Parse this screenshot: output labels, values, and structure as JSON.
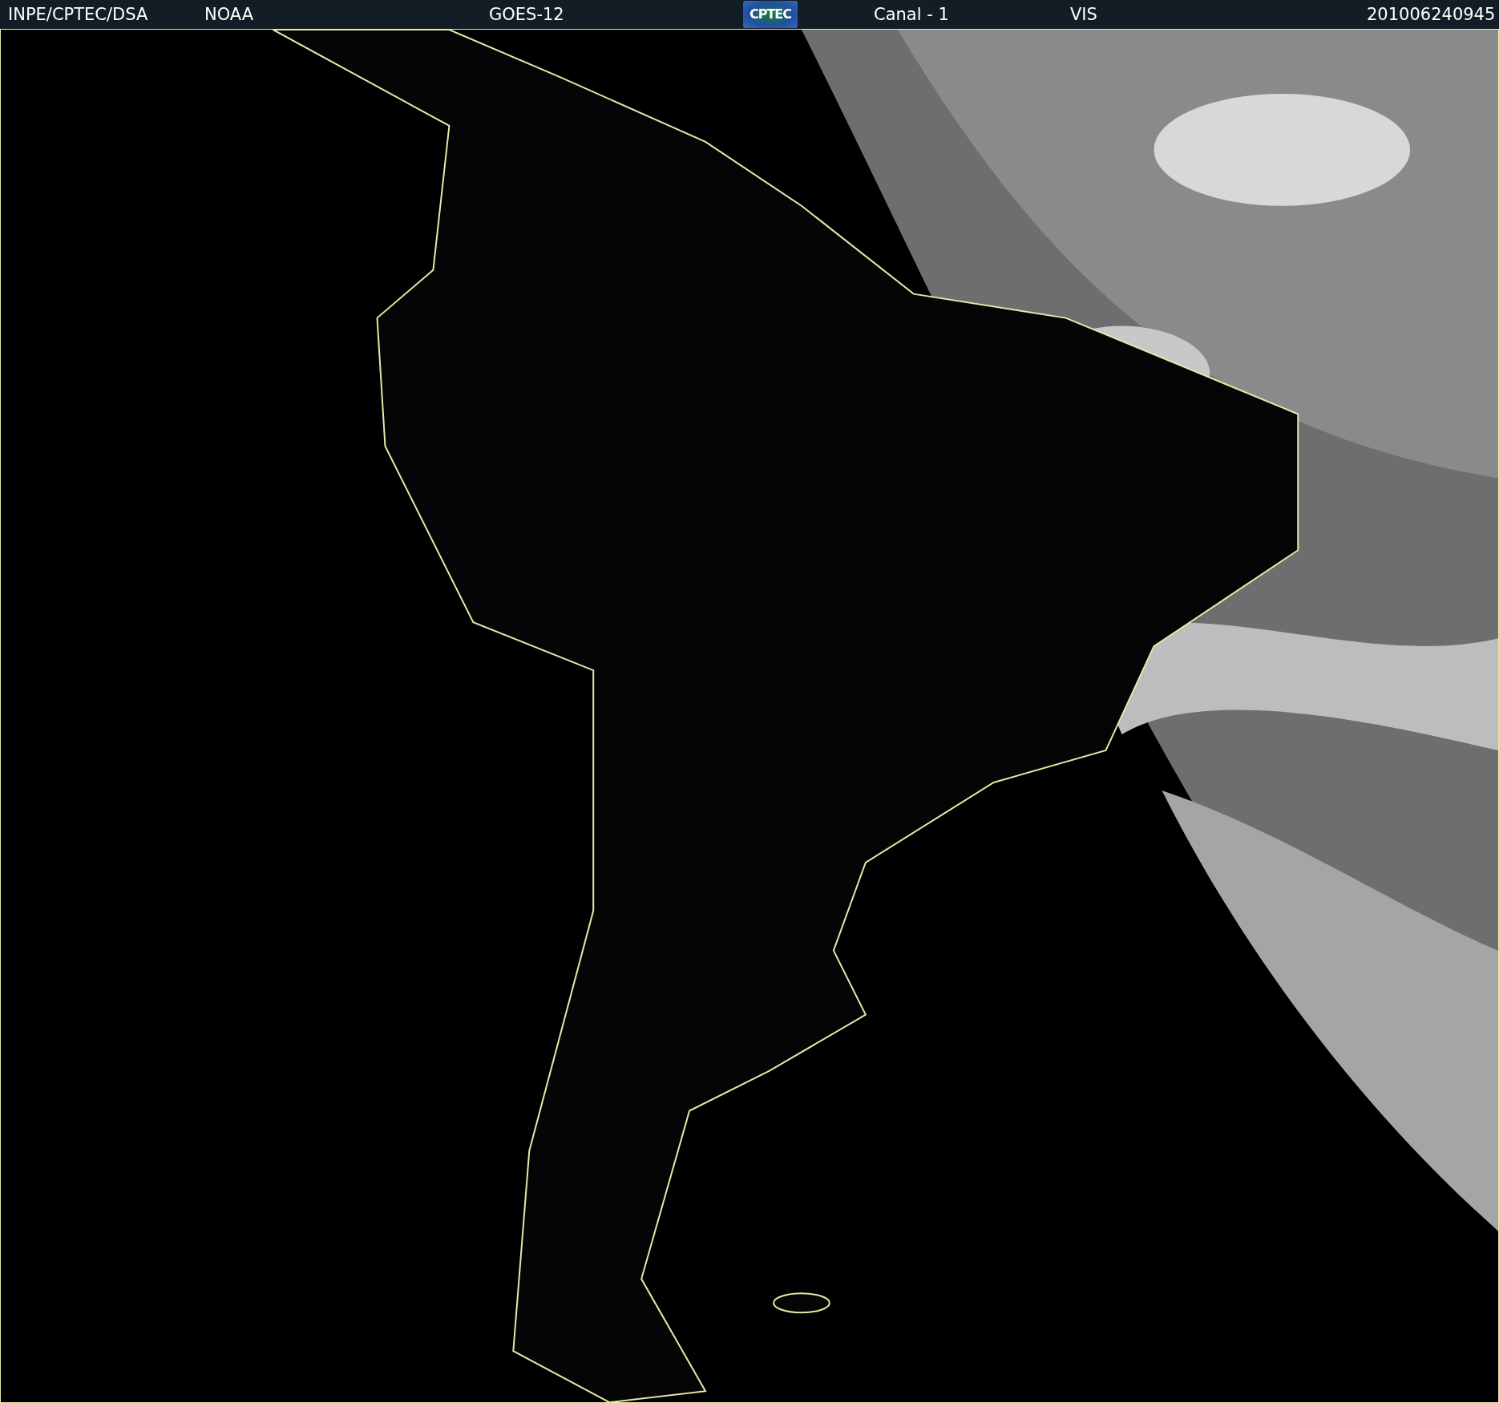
{
  "header": {
    "items": [
      {
        "kind": "text",
        "text": "INPE/CPTEC/DSA"
      },
      {
        "kind": "text",
        "text": "NOAA"
      },
      {
        "kind": "text",
        "text": "GOES-12"
      },
      {
        "kind": "logo",
        "text": "CPTEC"
      },
      {
        "kind": "text",
        "text": "Canal - 1"
      },
      {
        "kind": "text",
        "text": "VIS"
      },
      {
        "kind": "text",
        "text": "201006240945"
      }
    ]
  }
}
